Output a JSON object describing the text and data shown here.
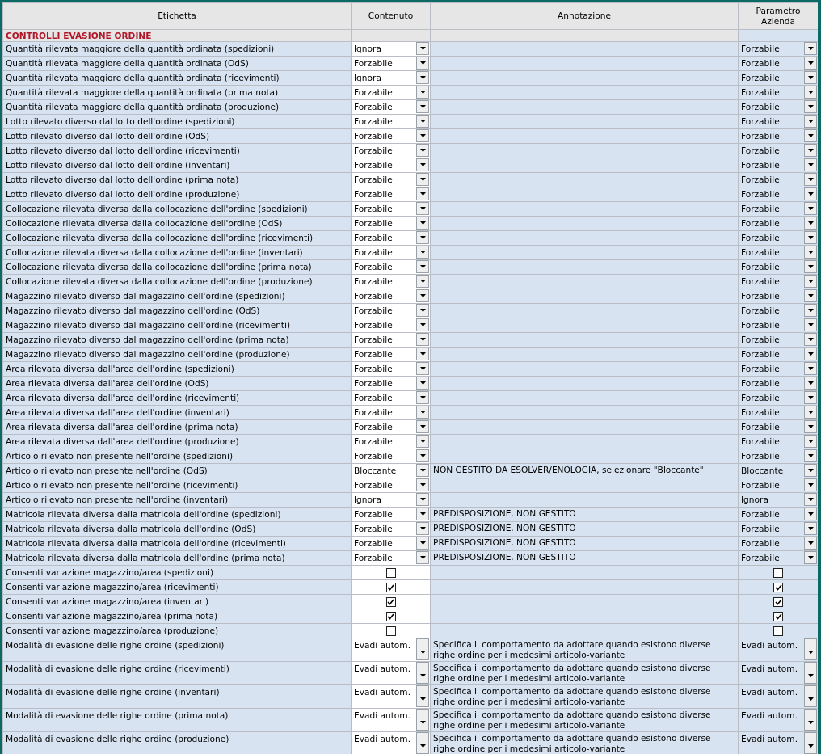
{
  "columns": [
    "Etichetta",
    "Contenuto",
    "Annotazione",
    "Parametro Azienda"
  ],
  "section": {
    "title": "CONTROLLI EVASIONE ORDINE"
  },
  "rows": [
    {
      "kind": "select",
      "label": "Quantità rilevata maggiore della quantità ordinata (spedizioni)",
      "content": "Ignora",
      "parameter": "Forzabile"
    },
    {
      "kind": "select",
      "label": "Quantità rilevata maggiore della quantità ordinata (OdS)",
      "content": "Forzabile",
      "parameter": "Forzabile"
    },
    {
      "kind": "select",
      "label": "Quantità rilevata maggiore della quantità ordinata (ricevimenti)",
      "content": "Ignora",
      "parameter": "Forzabile"
    },
    {
      "kind": "select",
      "label": "Quantità rilevata maggiore della quantità ordinata (prima nota)",
      "content": "Forzabile",
      "parameter": "Forzabile"
    },
    {
      "kind": "select",
      "label": "Quantità rilevata maggiore della quantità ordinata (produzione)",
      "content": "Forzabile",
      "parameter": "Forzabile"
    },
    {
      "kind": "select",
      "label": "Lotto rilevato diverso dal lotto dell'ordine (spedizioni)",
      "content": "Forzabile",
      "parameter": "Forzabile"
    },
    {
      "kind": "select",
      "label": "Lotto rilevato diverso dal lotto dell'ordine (OdS)",
      "content": "Forzabile",
      "parameter": "Forzabile"
    },
    {
      "kind": "select",
      "label": "Lotto rilevato diverso dal lotto dell'ordine (ricevimenti)",
      "content": "Forzabile",
      "parameter": "Forzabile"
    },
    {
      "kind": "select",
      "label": "Lotto rilevato diverso dal lotto dell'ordine (inventari)",
      "content": "Forzabile",
      "parameter": "Forzabile"
    },
    {
      "kind": "select",
      "label": "Lotto rilevato diverso dal lotto dell'ordine (prima nota)",
      "content": "Forzabile",
      "parameter": "Forzabile"
    },
    {
      "kind": "select",
      "label": "Lotto rilevato diverso dal lotto dell'ordine (produzione)",
      "content": "Forzabile",
      "parameter": "Forzabile"
    },
    {
      "kind": "select",
      "label": "Collocazione rilevata diversa dalla collocazione dell'ordine (spedizioni)",
      "content": "Forzabile",
      "parameter": "Forzabile"
    },
    {
      "kind": "select",
      "label": "Collocazione rilevata diversa dalla collocazione dell'ordine (OdS)",
      "content": "Forzabile",
      "parameter": "Forzabile"
    },
    {
      "kind": "select",
      "label": "Collocazione rilevata diversa dalla collocazione dell'ordine (ricevimenti)",
      "content": "Forzabile",
      "parameter": "Forzabile"
    },
    {
      "kind": "select",
      "label": "Collocazione rilevata diversa dalla collocazione dell'ordine (inventari)",
      "content": "Forzabile",
      "parameter": "Forzabile"
    },
    {
      "kind": "select",
      "label": "Collocazione rilevata diversa dalla collocazione dell'ordine (prima nota)",
      "content": "Forzabile",
      "parameter": "Forzabile"
    },
    {
      "kind": "select",
      "label": "Collocazione rilevata diversa dalla collocazione dell'ordine (produzione)",
      "content": "Forzabile",
      "parameter": "Forzabile"
    },
    {
      "kind": "select",
      "label": "Magazzino rilevato diverso dal magazzino dell'ordine (spedizioni)",
      "content": "Forzabile",
      "parameter": "Forzabile"
    },
    {
      "kind": "select",
      "label": "Magazzino rilevato diverso dal magazzino dell'ordine (OdS)",
      "content": "Forzabile",
      "parameter": "Forzabile"
    },
    {
      "kind": "select",
      "label": "Magazzino rilevato diverso dal magazzino dell'ordine (ricevimenti)",
      "content": "Forzabile",
      "parameter": "Forzabile"
    },
    {
      "kind": "select",
      "label": "Magazzino rilevato diverso dal magazzino dell'ordine (prima nota)",
      "content": "Forzabile",
      "parameter": "Forzabile"
    },
    {
      "kind": "select",
      "label": "Magazzino rilevato diverso dal magazzino dell'ordine (produzione)",
      "content": "Forzabile",
      "parameter": "Forzabile"
    },
    {
      "kind": "select",
      "label": "Area rilevata diversa dall'area dell'ordine (spedizioni)",
      "content": "Forzabile",
      "parameter": "Forzabile"
    },
    {
      "kind": "select",
      "label": "Area rilevata diversa dall'area dell'ordine (OdS)",
      "content": "Forzabile",
      "parameter": "Forzabile"
    },
    {
      "kind": "select",
      "label": "Area rilevata diversa dall'area dell'ordine (ricevimenti)",
      "content": "Forzabile",
      "parameter": "Forzabile"
    },
    {
      "kind": "select",
      "label": "Area rilevata diversa dall'area dell'ordine (inventari)",
      "content": "Forzabile",
      "parameter": "Forzabile"
    },
    {
      "kind": "select",
      "label": "Area rilevata diversa dall'area dell'ordine (prima nota)",
      "content": "Forzabile",
      "parameter": "Forzabile"
    },
    {
      "kind": "select",
      "label": "Area rilevata diversa dall'area dell'ordine (produzione)",
      "content": "Forzabile",
      "parameter": "Forzabile"
    },
    {
      "kind": "select",
      "label": "Articolo rilevato non presente nell'ordine (spedizioni)",
      "content": "Forzabile",
      "parameter": "Forzabile"
    },
    {
      "kind": "select",
      "label": "Articolo rilevato non presente nell'ordine (OdS)",
      "content": "Bloccante",
      "annotation": "NON GESTITO DA ESOLVER/ENOLOGIA, selezionare \"Bloccante\"",
      "parameter": "Bloccante"
    },
    {
      "kind": "select",
      "label": "Articolo rilevato non presente nell'ordine (ricevimenti)",
      "content": "Forzabile",
      "parameter": "Forzabile"
    },
    {
      "kind": "select",
      "label": "Articolo rilevato non presente nell'ordine (inventari)",
      "content": "Ignora",
      "parameter": "Ignora"
    },
    {
      "kind": "select",
      "label": "Matricola rilevata diversa dalla matricola dell'ordine (spedizioni)",
      "content": "Forzabile",
      "annotation": "PREDISPOSIZIONE, NON GESTITO",
      "parameter": "Forzabile"
    },
    {
      "kind": "select",
      "label": "Matricola rilevata diversa dalla matricola dell'ordine (OdS)",
      "content": "Forzabile",
      "annotation": "PREDISPOSIZIONE, NON GESTITO",
      "parameter": "Forzabile"
    },
    {
      "kind": "select",
      "label": "Matricola rilevata diversa dalla matricola dell'ordine (ricevimenti)",
      "content": "Forzabile",
      "annotation": "PREDISPOSIZIONE, NON GESTITO",
      "parameter": "Forzabile"
    },
    {
      "kind": "select",
      "label": "Matricola rilevata diversa dalla matricola dell'ordine (prima nota)",
      "content": "Forzabile",
      "annotation": "PREDISPOSIZIONE, NON GESTITO",
      "parameter": "Forzabile"
    },
    {
      "kind": "checkbox",
      "label": "Consenti variazione magazzino/area (spedizioni)",
      "content_checked": false,
      "parameter_checked": false
    },
    {
      "kind": "checkbox",
      "label": "Consenti variazione magazzino/area (ricevimenti)",
      "content_checked": true,
      "parameter_checked": true
    },
    {
      "kind": "checkbox",
      "label": "Consenti variazione magazzino/area (inventari)",
      "content_checked": true,
      "parameter_checked": true
    },
    {
      "kind": "checkbox",
      "label": "Consenti variazione magazzino/area (prima nota)",
      "content_checked": true,
      "parameter_checked": true
    },
    {
      "kind": "checkbox",
      "label": "Consenti variazione magazzino/area (produzione)",
      "content_checked": false,
      "parameter_checked": false
    },
    {
      "kind": "select_multiline",
      "label": "Modalità di evasione delle righe ordine (spedizioni)",
      "content": "Evadi autom.",
      "annotation": "Specifica il comportamento da adottare quando esistono diverse righe ordine per i medesimi articolo-variante",
      "parameter": "Evadi autom."
    },
    {
      "kind": "select_multiline",
      "label": "Modalità di evasione delle righe ordine (ricevimenti)",
      "content": "Evadi autom.",
      "annotation": "Specifica il comportamento da adottare quando esistono diverse righe ordine per i medesimi articolo-variante",
      "parameter": "Evadi autom."
    },
    {
      "kind": "select_multiline",
      "label": "Modalità di evasione delle righe ordine (inventari)",
      "content": "Evadi autom.",
      "annotation": "Specifica il comportamento da adottare quando esistono diverse righe ordine per i medesimi articolo-variante",
      "parameter": "Evadi autom."
    },
    {
      "kind": "select_multiline",
      "label": "Modalità di evasione delle righe ordine (prima nota)",
      "content": "Evadi autom.",
      "annotation": "Specifica il comportamento da adottare quando esistono diverse righe ordine per i medesimi articolo-variante",
      "parameter": "Evadi autom."
    },
    {
      "kind": "select_multiline",
      "label": "Modalità di evasione delle righe ordine (produzione)",
      "content": "Evadi autom.",
      "annotation": "Specifica il comportamento da adottare quando esistono diverse righe ordine per i medesimi articolo-variante",
      "parameter": "Evadi autom."
    }
  ]
}
